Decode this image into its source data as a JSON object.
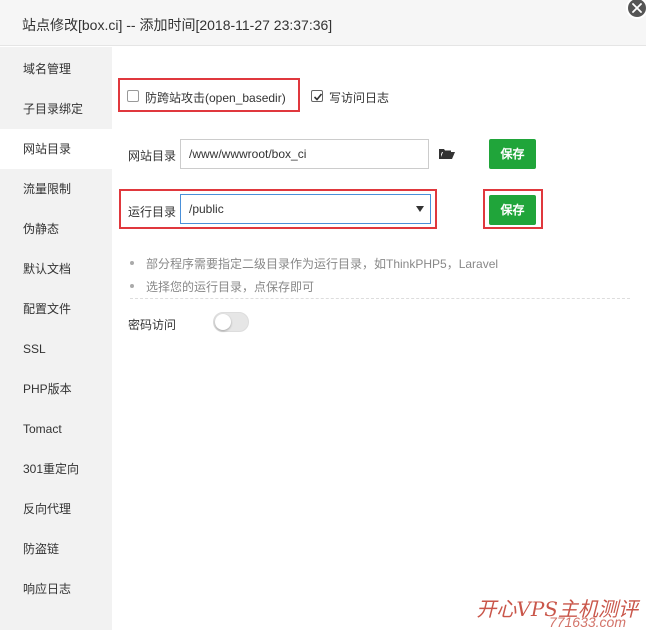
{
  "dialog": {
    "title": "站点修改[box.ci] -- 添加时间[2018-11-27 23:37:36]"
  },
  "sidebar": {
    "items": [
      {
        "label": "域名管理"
      },
      {
        "label": "子目录绑定"
      },
      {
        "label": "网站目录"
      },
      {
        "label": "流量限制"
      },
      {
        "label": "伪静态"
      },
      {
        "label": "默认文档"
      },
      {
        "label": "配置文件"
      },
      {
        "label": "SSL"
      },
      {
        "label": "PHP版本"
      },
      {
        "label": "Tomact"
      },
      {
        "label": "301重定向"
      },
      {
        "label": "反向代理"
      },
      {
        "label": "防盗链"
      },
      {
        "label": "响应日志"
      }
    ],
    "active_index": 2
  },
  "options": {
    "anti_xss_label": "防跨站攻击(open_basedir)",
    "anti_xss_checked": false,
    "access_log_label": "写访问日志",
    "access_log_checked": true
  },
  "site_dir": {
    "label": "网站目录",
    "value": "/www/wwwroot/box_ci",
    "save_label": "保存"
  },
  "run_dir": {
    "label": "运行目录",
    "selected": "/public",
    "save_label": "保存"
  },
  "tips": [
    "部分程序需要指定二级目录作为运行目录，如ThinkPHP5，Laravel",
    "选择您的运行目录，点保存即可"
  ],
  "password_access": {
    "label": "密码访问",
    "enabled": false
  },
  "watermark": {
    "text": "开心VPS主机测评",
    "sub": "771633.com"
  },
  "colors": {
    "accent_green": "#20a53a",
    "highlight_red": "#e0383d"
  }
}
